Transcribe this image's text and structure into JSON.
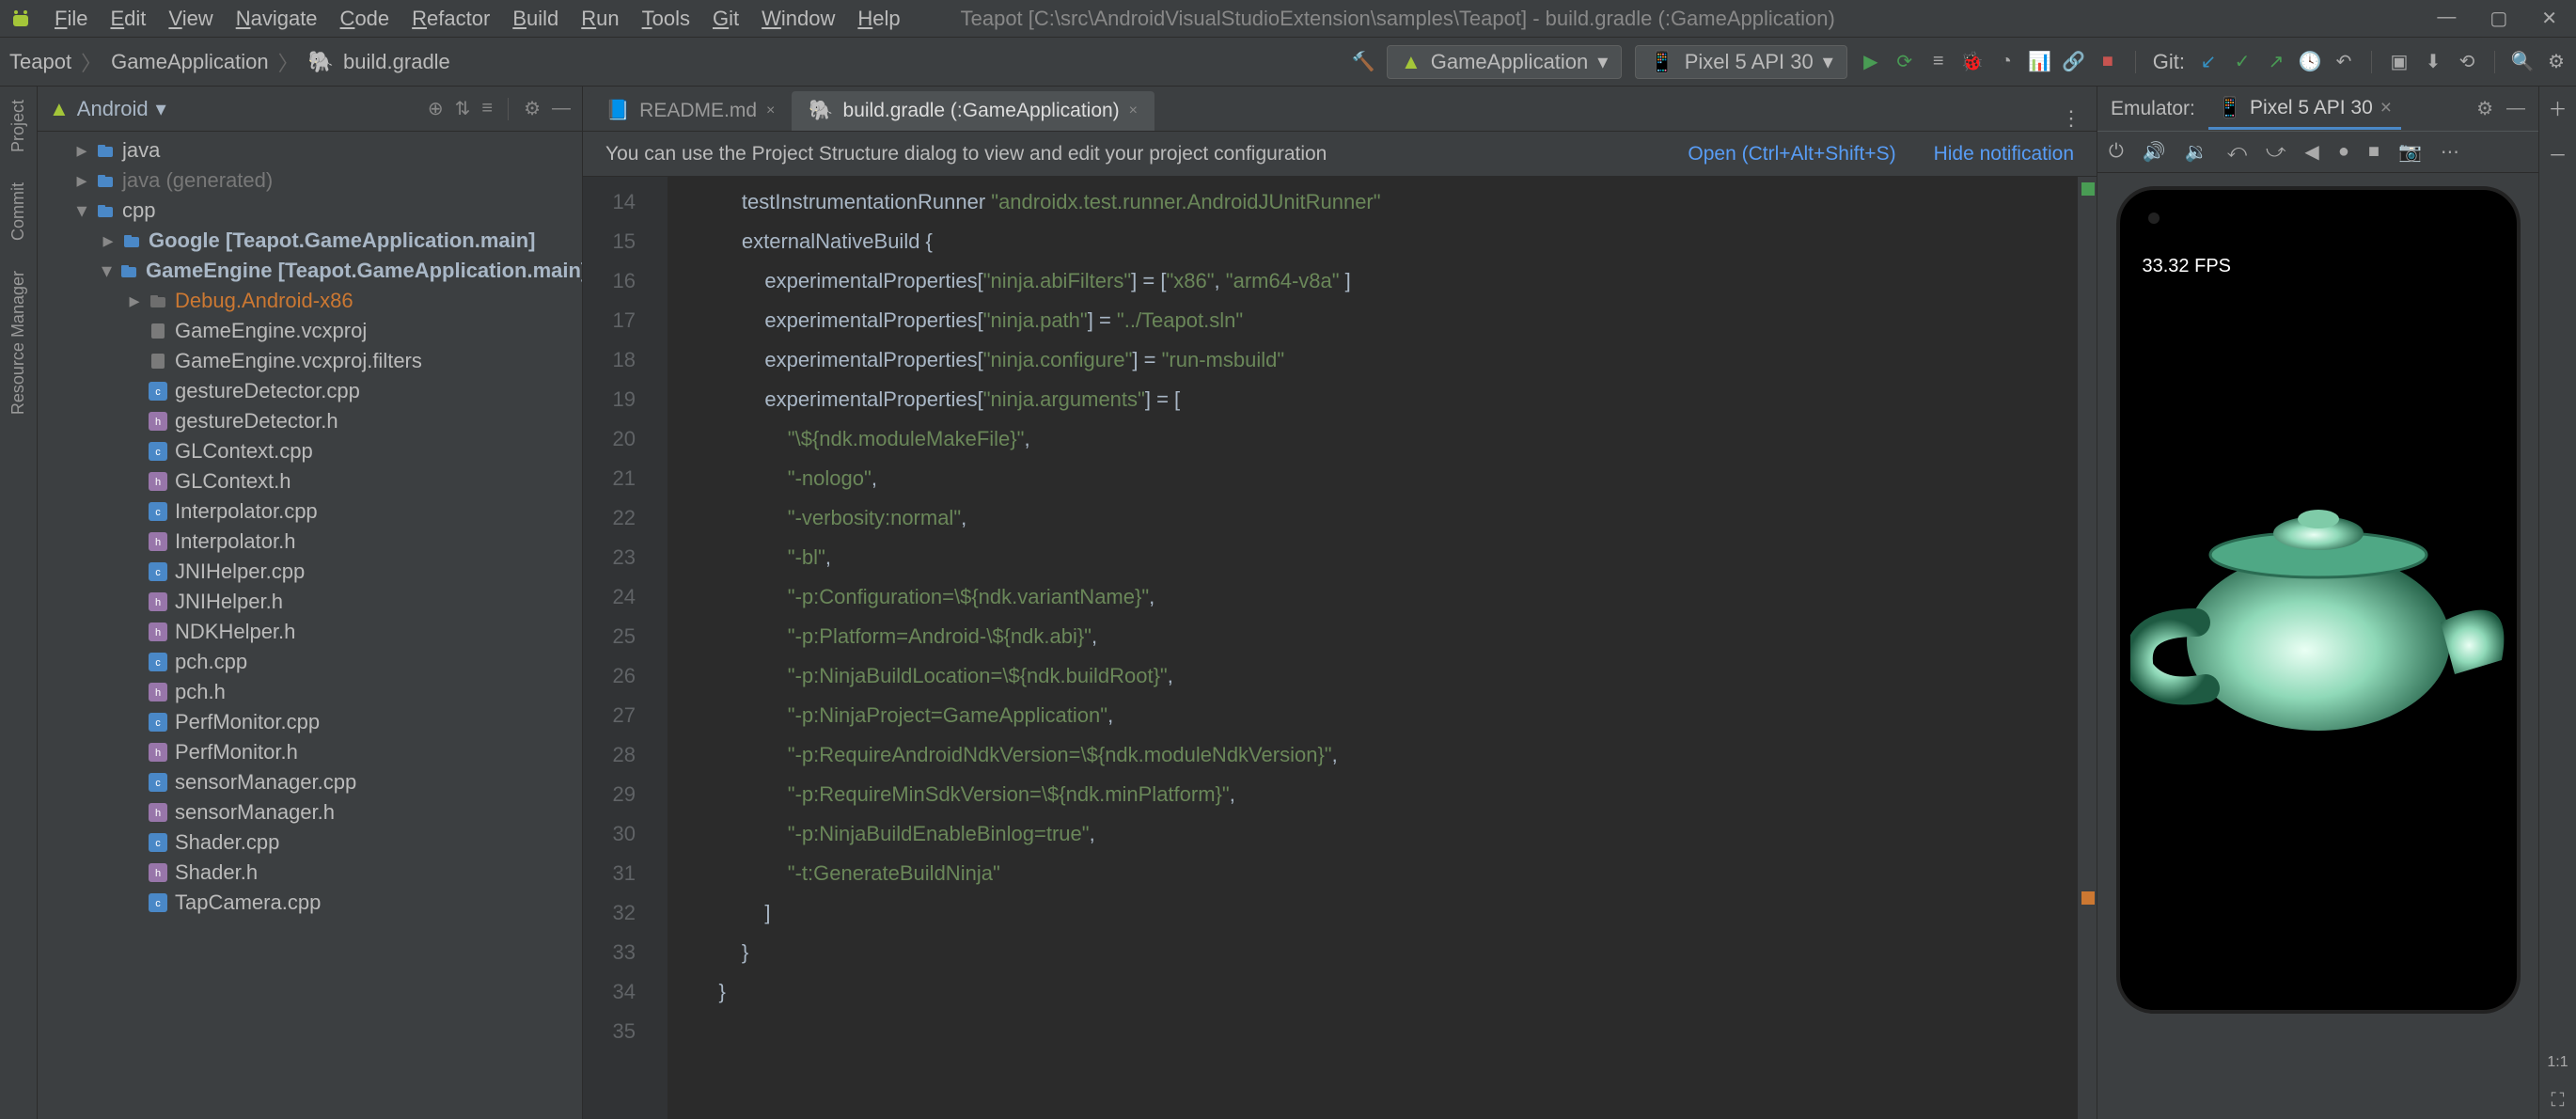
{
  "menu": [
    "File",
    "Edit",
    "View",
    "Navigate",
    "Code",
    "Refactor",
    "Build",
    "Run",
    "Tools",
    "Git",
    "Window",
    "Help"
  ],
  "windowTitle": "Teapot [C:\\src\\AndroidVisualStudioExtension\\samples\\Teapot] - build.gradle (:GameApplication)",
  "breadcrumb": [
    "Teapot",
    "GameApplication",
    "build.gradle"
  ],
  "runConfig": "GameApplication",
  "device": "Pixel 5 API 30",
  "gitLabel": "Git:",
  "projectView": {
    "title": "Android",
    "nodes": [
      {
        "depth": 1,
        "arrow": ">",
        "icon": "folder",
        "label": "java",
        "cls": ""
      },
      {
        "depth": 1,
        "arrow": ">",
        "icon": "folder",
        "label": "java (generated)",
        "cls": "dim"
      },
      {
        "depth": 1,
        "arrow": "v",
        "icon": "folder",
        "label": "cpp",
        "cls": ""
      },
      {
        "depth": 2,
        "arrow": ">",
        "icon": "folder",
        "label": "Google [Teapot.GameApplication.main]",
        "cls": "bold"
      },
      {
        "depth": 2,
        "arrow": "v",
        "icon": "folder",
        "label": "GameEngine [Teapot.GameApplication.main]",
        "cls": "bold"
      },
      {
        "depth": 3,
        "arrow": ">",
        "icon": "folder-grey",
        "label": "Debug.Android-x86",
        "cls": "gold"
      },
      {
        "depth": 3,
        "arrow": "",
        "icon": "file",
        "label": "GameEngine.vcxproj",
        "cls": ""
      },
      {
        "depth": 3,
        "arrow": "",
        "icon": "file",
        "label": "GameEngine.vcxproj.filters",
        "cls": ""
      },
      {
        "depth": 3,
        "arrow": "",
        "icon": "cpp",
        "label": "gestureDetector.cpp",
        "cls": ""
      },
      {
        "depth": 3,
        "arrow": "",
        "icon": "h",
        "label": "gestureDetector.h",
        "cls": ""
      },
      {
        "depth": 3,
        "arrow": "",
        "icon": "cpp",
        "label": "GLContext.cpp",
        "cls": ""
      },
      {
        "depth": 3,
        "arrow": "",
        "icon": "h",
        "label": "GLContext.h",
        "cls": ""
      },
      {
        "depth": 3,
        "arrow": "",
        "icon": "cpp",
        "label": "Interpolator.cpp",
        "cls": ""
      },
      {
        "depth": 3,
        "arrow": "",
        "icon": "h",
        "label": "Interpolator.h",
        "cls": ""
      },
      {
        "depth": 3,
        "arrow": "",
        "icon": "cpp",
        "label": "JNIHelper.cpp",
        "cls": ""
      },
      {
        "depth": 3,
        "arrow": "",
        "icon": "h",
        "label": "JNIHelper.h",
        "cls": ""
      },
      {
        "depth": 3,
        "arrow": "",
        "icon": "h",
        "label": "NDKHelper.h",
        "cls": ""
      },
      {
        "depth": 3,
        "arrow": "",
        "icon": "cpp",
        "label": "pch.cpp",
        "cls": ""
      },
      {
        "depth": 3,
        "arrow": "",
        "icon": "h",
        "label": "pch.h",
        "cls": ""
      },
      {
        "depth": 3,
        "arrow": "",
        "icon": "cpp",
        "label": "PerfMonitor.cpp",
        "cls": ""
      },
      {
        "depth": 3,
        "arrow": "",
        "icon": "h",
        "label": "PerfMonitor.h",
        "cls": ""
      },
      {
        "depth": 3,
        "arrow": "",
        "icon": "cpp",
        "label": "sensorManager.cpp",
        "cls": ""
      },
      {
        "depth": 3,
        "arrow": "",
        "icon": "h",
        "label": "sensorManager.h",
        "cls": ""
      },
      {
        "depth": 3,
        "arrow": "",
        "icon": "cpp",
        "label": "Shader.cpp",
        "cls": ""
      },
      {
        "depth": 3,
        "arrow": "",
        "icon": "h",
        "label": "Shader.h",
        "cls": ""
      },
      {
        "depth": 3,
        "arrow": "",
        "icon": "cpp",
        "label": "TapCamera.cpp",
        "cls": ""
      }
    ]
  },
  "tabs": [
    {
      "label": "README.md",
      "active": false,
      "icon": "md"
    },
    {
      "label": "build.gradle (:GameApplication)",
      "active": true,
      "icon": "gradle"
    }
  ],
  "banner": {
    "text": "You can use the Project Structure dialog to view and edit your project configuration",
    "open": "Open (Ctrl+Alt+Shift+S)",
    "hide": "Hide notification"
  },
  "code": {
    "firstLine": 14,
    "lines": [
      [
        {
          "t": "",
          "c": ""
        }
      ],
      [
        {
          "t": "        testInstrumentationRunner ",
          "c": "id"
        },
        {
          "t": "\"androidx.test.runner.AndroidJUnitRunner\"",
          "c": "str"
        }
      ],
      [
        {
          "t": "        externalNativeBuild {",
          "c": "id"
        }
      ],
      [
        {
          "t": "            experimentalProperties[",
          "c": "id"
        },
        {
          "t": "\"ninja.abiFilters\"",
          "c": "str"
        },
        {
          "t": "] = [",
          "c": "pun"
        },
        {
          "t": "\"x86\"",
          "c": "str"
        },
        {
          "t": ", ",
          "c": "pun"
        },
        {
          "t": "\"arm64-v8a\"",
          "c": "str"
        },
        {
          "t": " ]",
          "c": "pun"
        }
      ],
      [
        {
          "t": "            experimentalProperties[",
          "c": "id"
        },
        {
          "t": "\"ninja.path\"",
          "c": "str"
        },
        {
          "t": "] = ",
          "c": "pun"
        },
        {
          "t": "\"../Teapot.sln\"",
          "c": "str"
        }
      ],
      [
        {
          "t": "            experimentalProperties[",
          "c": "id"
        },
        {
          "t": "\"ninja.configure\"",
          "c": "str"
        },
        {
          "t": "] = ",
          "c": "pun"
        },
        {
          "t": "\"run-msbuild\"",
          "c": "str"
        }
      ],
      [
        {
          "t": "            experimentalProperties[",
          "c": "id"
        },
        {
          "t": "\"ninja.arguments\"",
          "c": "str"
        },
        {
          "t": "] = [",
          "c": "pun"
        }
      ],
      [
        {
          "t": "                ",
          "c": ""
        },
        {
          "t": "\"\\${ndk.moduleMakeFile}\"",
          "c": "str"
        },
        {
          "t": ",",
          "c": "pun"
        }
      ],
      [
        {
          "t": "                ",
          "c": ""
        },
        {
          "t": "\"-nologo\"",
          "c": "str"
        },
        {
          "t": ",",
          "c": "pun"
        }
      ],
      [
        {
          "t": "                ",
          "c": ""
        },
        {
          "t": "\"-verbosity:normal\"",
          "c": "str"
        },
        {
          "t": ",",
          "c": "pun"
        }
      ],
      [
        {
          "t": "                ",
          "c": ""
        },
        {
          "t": "\"-bl\"",
          "c": "str"
        },
        {
          "t": ",",
          "c": "pun"
        }
      ],
      [
        {
          "t": "                ",
          "c": ""
        },
        {
          "t": "\"-p:Configuration=\\${ndk.variantName}\"",
          "c": "str"
        },
        {
          "t": ",",
          "c": "pun"
        }
      ],
      [
        {
          "t": "                ",
          "c": ""
        },
        {
          "t": "\"-p:Platform=Android-\\${ndk.abi}\"",
          "c": "str"
        },
        {
          "t": ",",
          "c": "pun"
        }
      ],
      [
        {
          "t": "                ",
          "c": ""
        },
        {
          "t": "\"-p:NinjaBuildLocation=\\${ndk.buildRoot}\"",
          "c": "str"
        },
        {
          "t": ",",
          "c": "pun"
        }
      ],
      [
        {
          "t": "                ",
          "c": ""
        },
        {
          "t": "\"-p:NinjaProject=GameApplication\"",
          "c": "str"
        },
        {
          "t": ",",
          "c": "pun"
        }
      ],
      [
        {
          "t": "                ",
          "c": ""
        },
        {
          "t": "\"-p:RequireAndroidNdkVersion=\\${ndk.moduleNdkVersion}\"",
          "c": "str"
        },
        {
          "t": ",",
          "c": "pun"
        }
      ],
      [
        {
          "t": "                ",
          "c": ""
        },
        {
          "t": "\"-p:RequireMinSdkVersion=\\${ndk.minPlatform}\"",
          "c": "str"
        },
        {
          "t": ",",
          "c": "pun"
        }
      ],
      [
        {
          "t": "                ",
          "c": ""
        },
        {
          "t": "\"-p:NinjaBuildEnableBinlog=true\"",
          "c": "str"
        },
        {
          "t": ",",
          "c": "pun"
        }
      ],
      [
        {
          "t": "                ",
          "c": ""
        },
        {
          "t": "\"-t:GenerateBuildNinja\"",
          "c": "str"
        }
      ],
      [
        {
          "t": "            ]",
          "c": "pun"
        }
      ],
      [
        {
          "t": "        }",
          "c": "pun"
        }
      ],
      [
        {
          "t": "    }",
          "c": "pun"
        }
      ]
    ]
  },
  "emulator": {
    "title": "Emulator:",
    "device": "Pixel 5 API 30",
    "fps": "33.32 FPS"
  },
  "rightRail": {
    "zoom": "1:1"
  },
  "leftRail": [
    "Project",
    "Commit",
    "Resource Manager"
  ]
}
